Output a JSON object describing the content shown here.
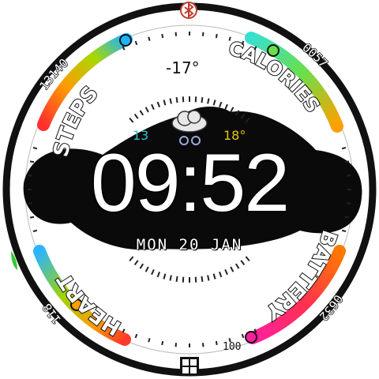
{
  "time": "09:52",
  "date": {
    "day": "MON",
    "num": "20",
    "month": "JAN"
  },
  "weather": {
    "temp": "-17°",
    "low": "13",
    "high": "18°",
    "icon": "snow-cloud-icon"
  },
  "labels": {
    "steps": "STEPS",
    "calories": "CALORIES",
    "heart": "HEART",
    "battery": "BATTERY"
  },
  "values": {
    "steps": "13140",
    "calories": "0057",
    "heart": "118",
    "battery": "0632"
  },
  "scale_mark": "100",
  "icons": {
    "top": "bluetooth-icon",
    "bottom": "grid-icon"
  },
  "colors": {
    "accent_ring": "#2a2a2a",
    "bt": "#c0392b",
    "low": "#2cc0c8",
    "high": "#e6c800"
  }
}
